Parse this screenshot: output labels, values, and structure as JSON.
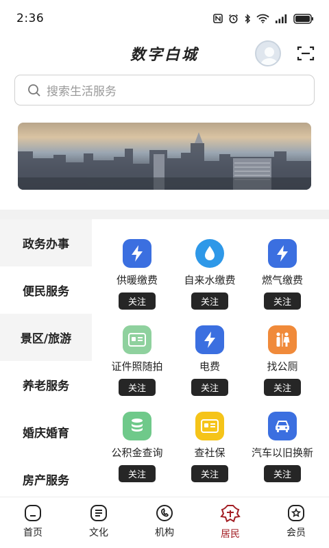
{
  "status_bar": {
    "time": "2:36"
  },
  "header": {
    "title": "数字白城"
  },
  "search": {
    "placeholder": "搜索生活服务"
  },
  "sidebar": {
    "categories": [
      {
        "label": "政务办事"
      },
      {
        "label": "便民服务"
      },
      {
        "label": "景区/旅游"
      },
      {
        "label": "养老服务"
      },
      {
        "label": "婚庆婚育"
      },
      {
        "label": "房产服务"
      }
    ]
  },
  "services": [
    {
      "label": "供暖缴费",
      "icon": "lightning-icon",
      "color": "#3b6fe0",
      "follow": "关注"
    },
    {
      "label": "自来水缴费",
      "icon": "water-drop-icon",
      "color": "#2e98e8",
      "follow": "关注"
    },
    {
      "label": "燃气缴费",
      "icon": "lightning-icon",
      "color": "#3b6fe0",
      "follow": "关注"
    },
    {
      "label": "证件照随拍",
      "icon": "id-card-icon",
      "color": "#5fbf7a",
      "follow": "关注"
    },
    {
      "label": "电费",
      "icon": "lightning-icon",
      "color": "#3b6fe0",
      "follow": "关注"
    },
    {
      "label": "找公厕",
      "icon": "restroom-icon",
      "color": "#f08a3a",
      "follow": "关注"
    },
    {
      "label": "公积金查询",
      "icon": "coins-icon",
      "color": "#5fbf7a",
      "follow": "关注"
    },
    {
      "label": "查社保",
      "icon": "id-card-icon",
      "color": "#f5c419",
      "follow": "关注"
    },
    {
      "label": "汽车以旧换新",
      "icon": "car-icon",
      "color": "#3b6fe0",
      "follow": "关注"
    }
  ],
  "tabbar": {
    "items": [
      {
        "label": "首页",
        "icon": "home-icon"
      },
      {
        "label": "文化",
        "icon": "culture-icon"
      },
      {
        "label": "机构",
        "icon": "institution-icon"
      },
      {
        "label": "居民",
        "icon": "resident-icon"
      },
      {
        "label": "会员",
        "icon": "member-icon"
      }
    ],
    "active_index": 3,
    "active_color": "#a31e24"
  }
}
